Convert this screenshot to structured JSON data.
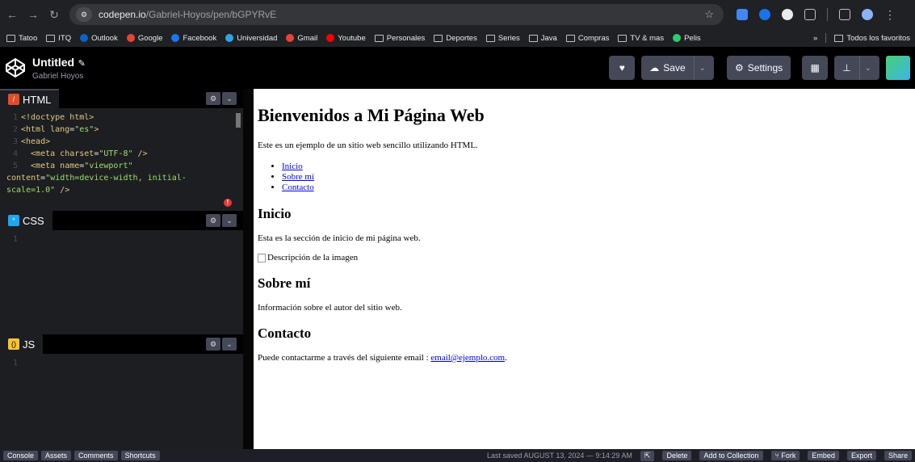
{
  "browser": {
    "url_host": "codepen.io",
    "url_path": "/Gabriel-Hoyos/pen/bGPYRvE"
  },
  "bookmarks": [
    "Tatoo",
    "ITQ",
    "Outlook",
    "Google",
    "Facebook",
    "Universidad",
    "Gmail",
    "Youtube",
    "Personales",
    "Deportes",
    "Series",
    "Java",
    "Compras",
    "TV & mas",
    "Pelis"
  ],
  "bookmarks_more": "»",
  "bookmarks_all": "Todos los favoritos",
  "header": {
    "title": "Untitled",
    "author": "Gabriel Hoyos",
    "save_label": "Save",
    "settings_label": "Settings"
  },
  "editors": {
    "html_label": "HTML",
    "css_label": "CSS",
    "js_label": "JS",
    "html_lines": [
      {
        "n": "1",
        "parts": [
          [
            "tag",
            "<!doctype html>"
          ]
        ]
      },
      {
        "n": "2",
        "parts": [
          [
            "tag",
            "<html "
          ],
          [
            "an",
            "lang"
          ],
          [
            "attr",
            "="
          ],
          [
            "str",
            "\"es\""
          ],
          [
            "tag",
            ">"
          ]
        ]
      },
      {
        "n": "3",
        "parts": [
          [
            "tag",
            "<head>"
          ]
        ]
      },
      {
        "n": "4",
        "parts": [
          [
            "tag",
            "  <meta "
          ],
          [
            "an",
            "charset"
          ],
          [
            "attr",
            "="
          ],
          [
            "str",
            "\"UTF-8\""
          ],
          [
            "tag",
            " />"
          ]
        ]
      },
      {
        "n": "5",
        "parts": [
          [
            "tag",
            "  <meta "
          ],
          [
            "an",
            "name"
          ],
          [
            "attr",
            "="
          ],
          [
            "str",
            "\"viewport\""
          ]
        ]
      },
      {
        "n": "",
        "parts": [
          [
            "an",
            "content"
          ],
          [
            "attr",
            "="
          ],
          [
            "str",
            "\"width=device-width, initial-"
          ]
        ]
      },
      {
        "n": "",
        "parts": [
          [
            "str",
            "scale=1.0\""
          ],
          [
            "tag",
            " />"
          ]
        ]
      }
    ],
    "css_line": "1",
    "js_line": "1"
  },
  "preview": {
    "h1": "Bienvenidos a Mi Página Web",
    "intro": "Este es un ejemplo de un sitio web sencillo utilizando HTML.",
    "nav": [
      "Inicio",
      "Sobre mí",
      "Contacto"
    ],
    "inicio_h": "Inicio",
    "inicio_p": "Esta es la sección de inicio de mi página web.",
    "img_alt": "Descripción de la imagen",
    "sobre_h": "Sobre mí",
    "sobre_p": "Información sobre el autor del sitio web.",
    "contacto_h": "Contacto",
    "contacto_p": "Puede contactarme a través del siguiente email : ",
    "email": "email@ejemplo.com",
    "email_after": "."
  },
  "footer": {
    "console": "Console",
    "assets": "Assets",
    "comments": "Comments",
    "shortcuts": "Shortcuts",
    "last_saved": "Last saved AUGUST 13, 2024 — 9:14:29 AM",
    "delete": "Delete",
    "add_collection": "Add to Collection",
    "fork": "Fork",
    "embed": "Embed",
    "export": "Export",
    "share": "Share"
  },
  "colors": {
    "html_icon": "#e34c26",
    "css_icon": "#1ea6f0",
    "js_icon": "#f7c430",
    "link": "#0000ee"
  }
}
